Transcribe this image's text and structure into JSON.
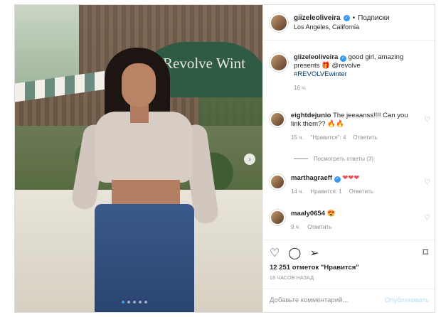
{
  "post": {
    "username": "giizeleoliveira",
    "follow_label": "Подписки",
    "separator": "•",
    "location": "Los Angeles, California",
    "image_sign_text": "Revolve Wint",
    "carousel_dots": 5,
    "carousel_active": 1
  },
  "caption": {
    "username": "giizeleoliveira",
    "text": "good girl, amazing presents 🎁 @revolve",
    "hashtag": "#REVOLVEwinter",
    "time": "16 ч."
  },
  "comments": [
    {
      "username": "eightdejunio",
      "text": "The jeeaanss!!!! Can you link them?? ",
      "emoji": "🔥🔥",
      "time": "15 ч.",
      "likes": "\"Нравится\": 4",
      "reply": "Ответить",
      "view_replies": "Посмотреть ответы (3)"
    },
    {
      "username": "marthagraeff",
      "text": "",
      "emoji": "❤❤❤",
      "time": "14 ч.",
      "likes": "Нравится: 1",
      "reply": "Ответить"
    },
    {
      "username": "maaly0654",
      "text": "",
      "emoji": "😍",
      "time": "9 ч.",
      "reply": "Ответить"
    }
  ],
  "actions": {
    "likes_text": "12 251 отметок \"Нравится\"",
    "time_ago": "18 ЧАСОВ НАЗАД",
    "comment_placeholder": "Добавьте комментарий...",
    "publish_label": "Опубликовать"
  },
  "icons": {
    "like": "heart-icon",
    "comment": "comment-icon",
    "share": "share-icon",
    "save": "bookmark-icon",
    "next": "chevron-right-icon"
  },
  "colors": {
    "accent": "#3897f0",
    "muted": "#8e8e8e",
    "publish_disabled": "#b2dffc"
  }
}
